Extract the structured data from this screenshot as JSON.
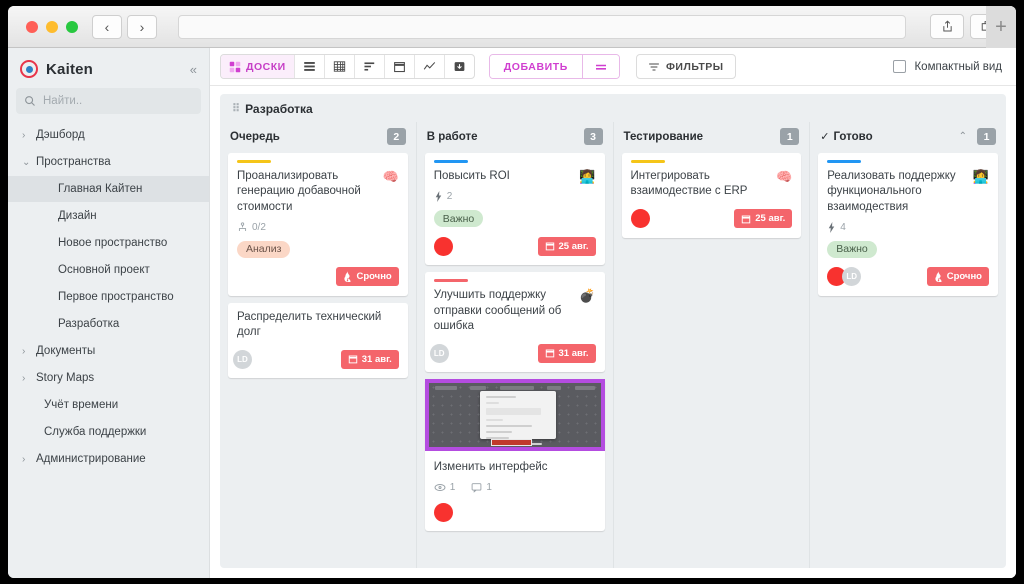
{
  "browser": {
    "back_label": "‹",
    "forward_label": "›",
    "url_value": "",
    "url_placeholder": "",
    "share_icon": "share-icon",
    "tabs_icon": "tabs-icon",
    "new_tab_label": "+"
  },
  "sidebar": {
    "brand": "Kaiten",
    "collapse_label": "«",
    "search_placeholder": "Найти..",
    "items": [
      {
        "label": "Дэшборд",
        "chevron": "›",
        "level": 0,
        "active": false
      },
      {
        "label": "Пространства",
        "chevron": "⌄",
        "level": 0,
        "active": false
      },
      {
        "label": "Главная Кайтен",
        "chevron": "",
        "level": 1,
        "active": true
      },
      {
        "label": "Дизайн",
        "chevron": "",
        "level": 1,
        "active": false
      },
      {
        "label": "Новое пространство",
        "chevron": "",
        "level": 1,
        "active": false
      },
      {
        "label": "Основной проект",
        "chevron": "",
        "level": 1,
        "active": false
      },
      {
        "label": "Первое пространство",
        "chevron": "",
        "level": 1,
        "active": false
      },
      {
        "label": "Разработка",
        "chevron": "",
        "level": 1,
        "active": false
      },
      {
        "label": "Документы",
        "chevron": "›",
        "level": 0,
        "active": false
      },
      {
        "label": "Story Maps",
        "chevron": "›",
        "level": 0,
        "active": false
      },
      {
        "label": "Учёт времени",
        "chevron": "",
        "level": 0,
        "active": false,
        "nochev": true
      },
      {
        "label": "Служба поддержки",
        "chevron": "",
        "level": 0,
        "active": false,
        "nochev": true
      },
      {
        "label": "Администрирование",
        "chevron": "›",
        "level": 0,
        "active": false
      }
    ]
  },
  "toolbar": {
    "views": [
      {
        "label": "ДОСКИ",
        "icon": "boards-icon",
        "active": true
      },
      {
        "label": "",
        "icon": "list-icon",
        "active": false
      },
      {
        "label": "",
        "icon": "grid-icon",
        "active": false
      },
      {
        "label": "",
        "icon": "sort-icon",
        "active": false
      },
      {
        "label": "",
        "icon": "calendar-icon",
        "active": false
      },
      {
        "label": "",
        "icon": "chart-icon",
        "active": false
      },
      {
        "label": "",
        "icon": "archive-icon",
        "active": false
      }
    ],
    "add_label": "ДОБАВИТЬ",
    "add_menu_icon": "equals-icon",
    "filters_label": "ФИЛЬТРЫ",
    "filters_icon": "filter-icon",
    "compact_label": "Компактный вид",
    "compact_checked": false,
    "accent_color": "#d03fd0"
  },
  "board": {
    "title": "Разработка",
    "columns": [
      {
        "name": "Очередь",
        "count": "2",
        "check": false,
        "collapse": false,
        "cards": [
          {
            "bar_color": "#f5c518",
            "title": "Проанализировать генерацию добавочной стоимости",
            "icon": "brain-icon",
            "meta": {
              "icon": "subtasks-icon",
              "text": "0/2"
            },
            "tag": {
              "label": "Анализ",
              "style": "peach"
            },
            "avatars": [],
            "pill": {
              "label": "Срочно",
              "icon": "fire-icon",
              "style": "urgent"
            },
            "picture": false
          },
          {
            "bar_color": "",
            "title": "Распределить технический долг",
            "icon": "",
            "meta": null,
            "tag": null,
            "avatars": [
              {
                "type": "gray",
                "initials": "LD"
              }
            ],
            "pill": {
              "label": "31 авг.",
              "icon": "calendar-icon",
              "style": "date"
            },
            "picture": false
          }
        ]
      },
      {
        "name": "В работе",
        "count": "3",
        "check": false,
        "collapse": false,
        "cards": [
          {
            "bar_color": "#2196f3",
            "title": "Повысить ROI",
            "icon": "person-computer-icon",
            "meta": {
              "icon": "priority-icon",
              "text": "2"
            },
            "tag": {
              "label": "Важно",
              "style": "green"
            },
            "avatars": [
              {
                "type": "red",
                "initials": ""
              }
            ],
            "pill": {
              "label": "25 авг.",
              "icon": "calendar-icon",
              "style": "date"
            },
            "picture": false
          },
          {
            "bar_color": "#f4656b",
            "title": "Улучшить поддержку отправки сообщений об ошибка",
            "icon": "bomb-icon",
            "meta": null,
            "tag": null,
            "avatars": [
              {
                "type": "gray",
                "initials": "LD"
              }
            ],
            "pill": {
              "label": "31 авг.",
              "icon": "calendar-icon",
              "style": "date"
            },
            "picture": false
          },
          {
            "bar_color": "",
            "title": "Изменить интерфейс",
            "icon": "",
            "meta": {
              "icon": "link-icon",
              "text": "1",
              "icon2": "comment-icon",
              "text2": "1"
            },
            "tag": null,
            "avatars": [
              {
                "type": "red",
                "initials": ""
              }
            ],
            "pill": null,
            "picture": true,
            "picture_border": "#b44ce0"
          }
        ]
      },
      {
        "name": "Тестирование",
        "count": "1",
        "check": false,
        "collapse": false,
        "cards": [
          {
            "bar_color": "#f5c518",
            "title": "Интегрировать взаимодествие с ERP",
            "icon": "brain-icon",
            "meta": null,
            "tag": null,
            "avatars": [
              {
                "type": "red",
                "initials": ""
              }
            ],
            "pill": {
              "label": "25 авг.",
              "icon": "calendar-icon",
              "style": "date"
            },
            "picture": false
          }
        ]
      },
      {
        "name": "Готово",
        "count": "1",
        "check": true,
        "check_glyph": "✓",
        "collapse": true,
        "collapse_glyph": "⌃",
        "cards": [
          {
            "bar_color": "#2196f3",
            "title": "Реализовать поддержку функционального взаимодествия",
            "icon": "person-computer-icon",
            "meta": {
              "icon": "priority-icon",
              "text": "4"
            },
            "tag": {
              "label": "Важно",
              "style": "green"
            },
            "avatars": [
              {
                "type": "red",
                "initials": ""
              },
              {
                "type": "gray",
                "initials": "LD"
              }
            ],
            "pill": {
              "label": "Срочно",
              "icon": "fire-icon",
              "style": "urgent"
            },
            "picture": false
          }
        ]
      }
    ]
  }
}
